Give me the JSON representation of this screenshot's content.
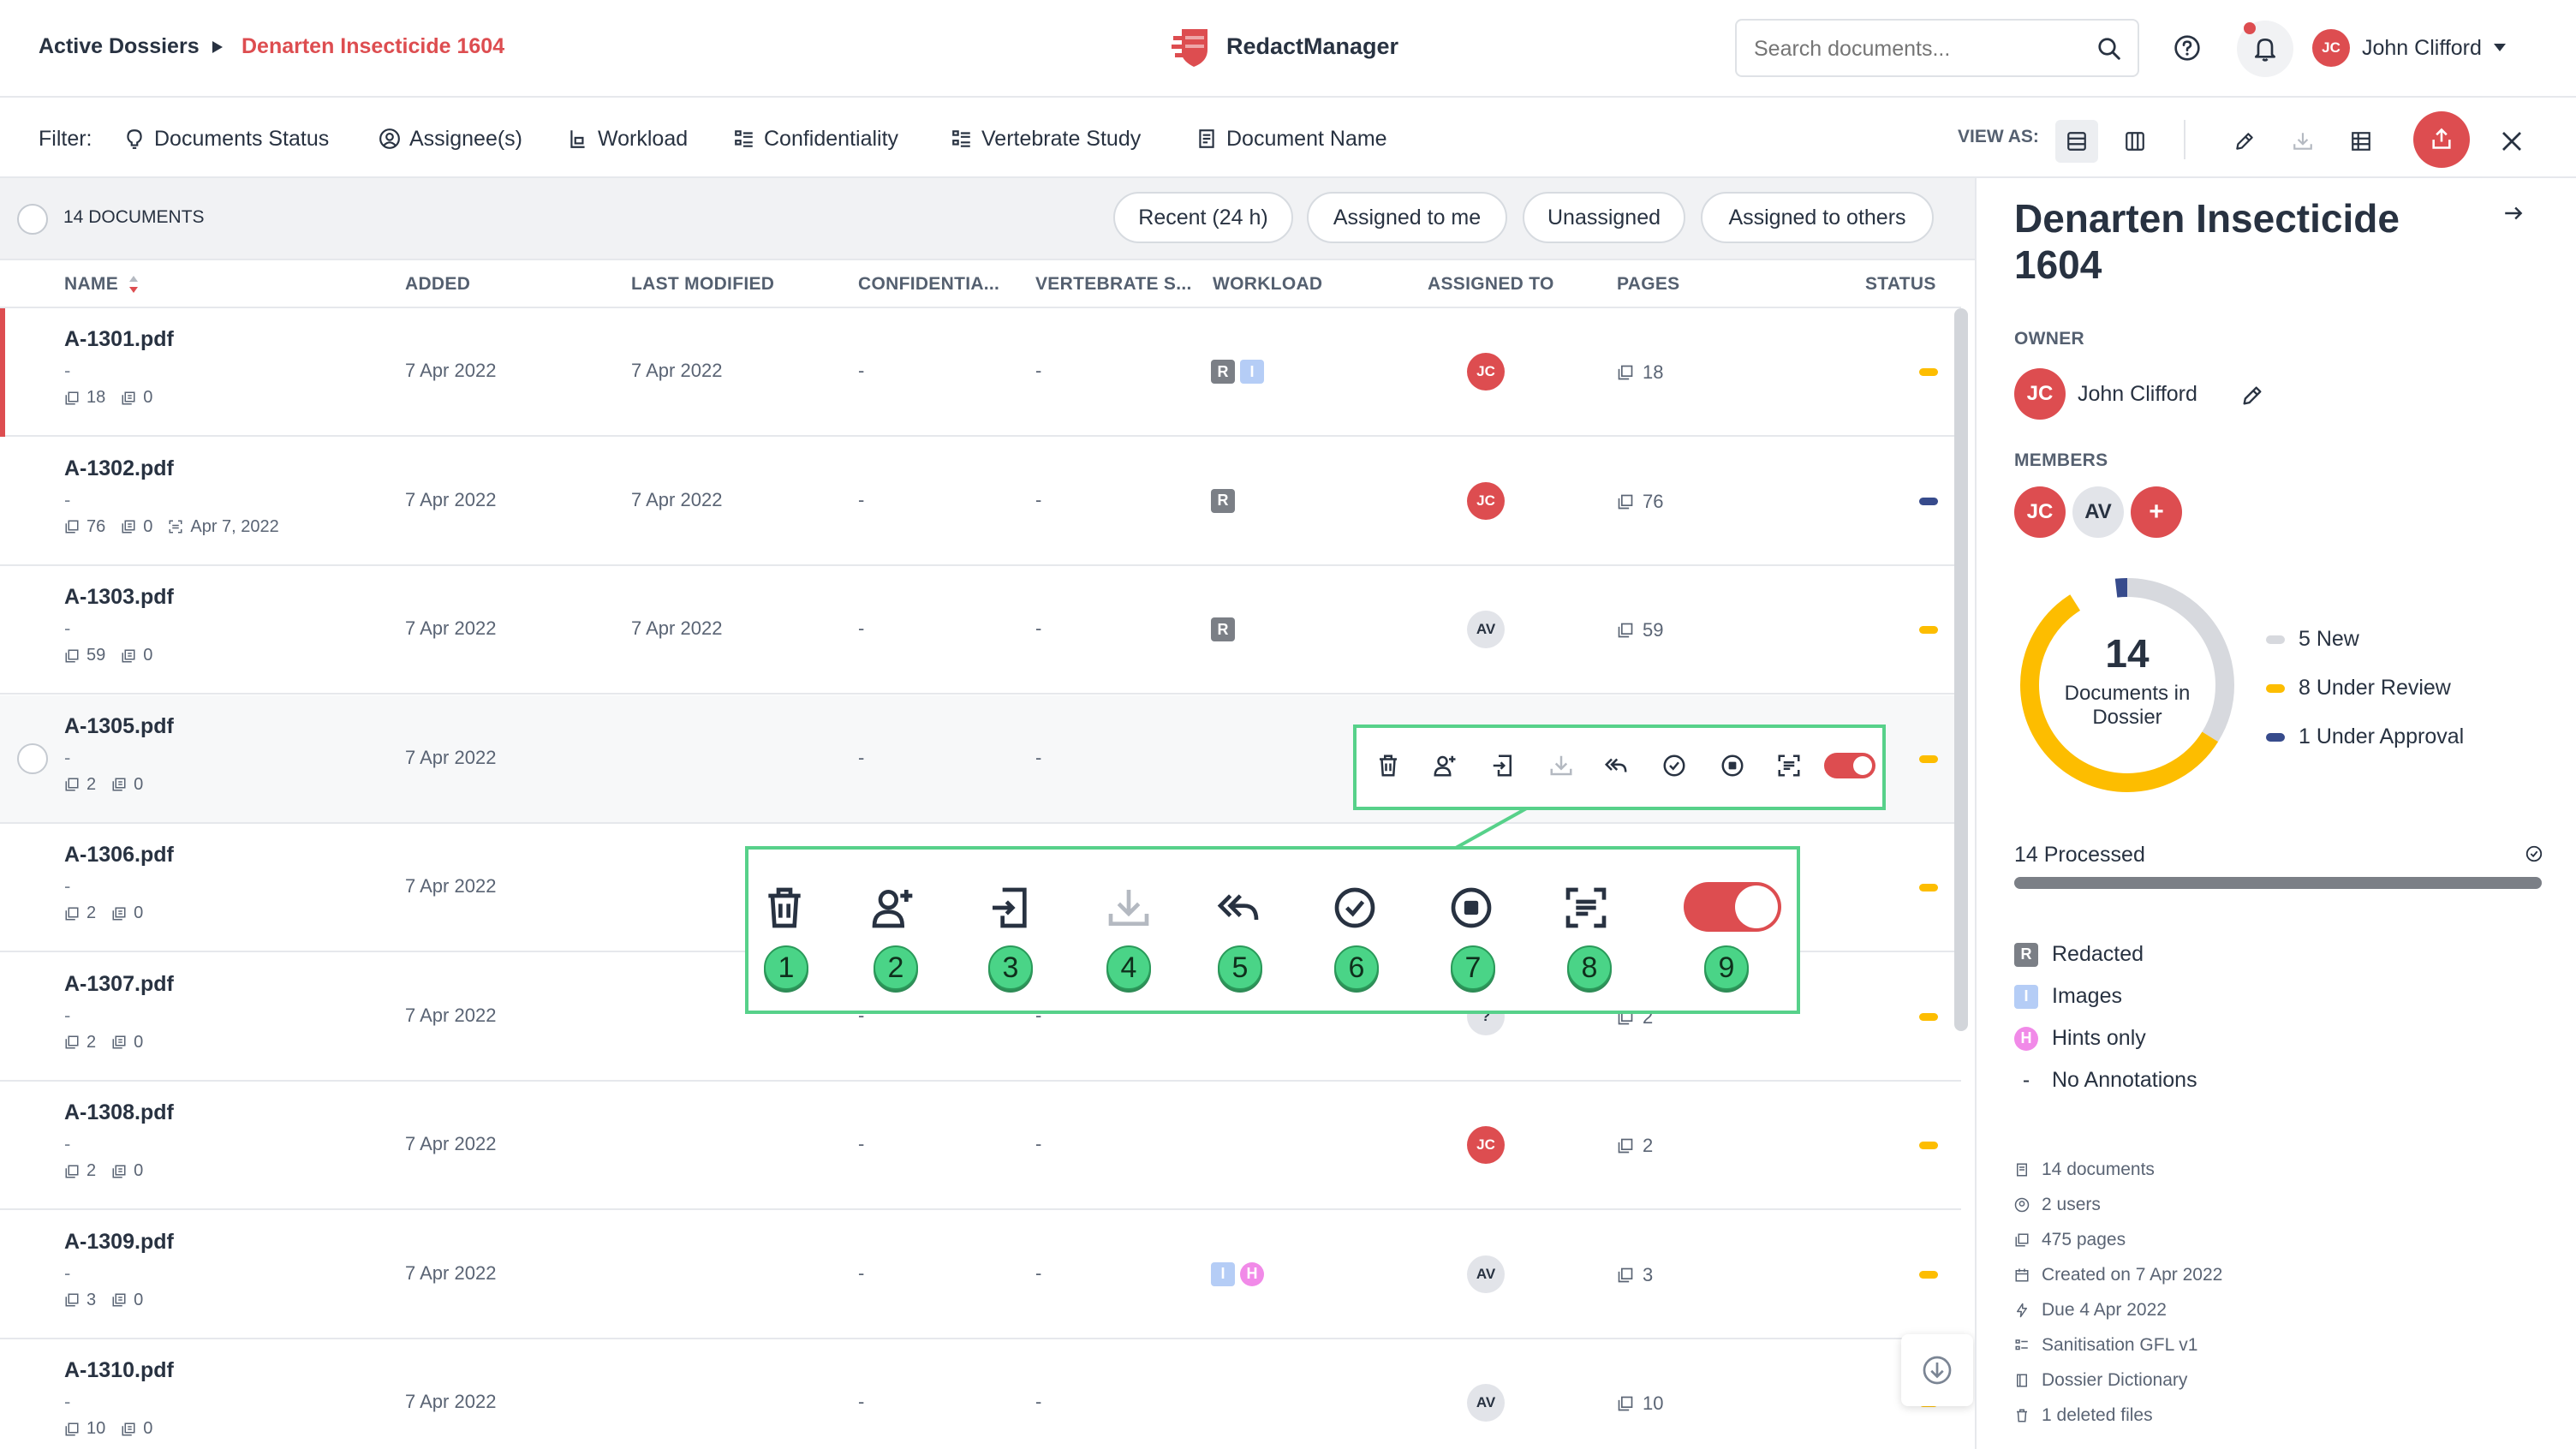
{
  "header": {
    "breadcrumb_root": "Active Dossiers",
    "breadcrumb_current": "Denarten Insecticide 1604",
    "app_name": "RedactManager",
    "search_placeholder": "Search documents...",
    "user_initials": "JC",
    "user_name": "John Clifford"
  },
  "filters": {
    "label": "Filter:",
    "items": [
      "Documents Status",
      "Assignee(s)",
      "Workload",
      "Confidentiality",
      "Vertebrate Study",
      "Document Name"
    ],
    "view_as_label": "VIEW AS:"
  },
  "list": {
    "count_label": "14 DOCUMENTS",
    "quick_filters": [
      "Recent (24 h)",
      "Assigned to me",
      "Unassigned",
      "Assigned to others"
    ],
    "columns": [
      "NAME",
      "ADDED",
      "LAST MODIFIED",
      "CONFIDENTIA...",
      "VERTEBRATE S...",
      "WORKLOAD",
      "ASSIGNED TO",
      "PAGES",
      "STATUS"
    ],
    "rows": [
      {
        "name": "A-1301.pdf",
        "sub": "-",
        "pages_meta": "18",
        "files_meta": "0",
        "ocr_date": "",
        "added": "7 Apr 2022",
        "modified": "7 Apr 2022",
        "conf": "-",
        "vert": "-",
        "workload": [
          "R",
          "I"
        ],
        "assigned": "JC",
        "pages": "18",
        "status": "under-review"
      },
      {
        "name": "A-1302.pdf",
        "sub": "-",
        "pages_meta": "76",
        "files_meta": "0",
        "ocr_date": "Apr 7, 2022",
        "added": "7 Apr 2022",
        "modified": "7 Apr 2022",
        "conf": "-",
        "vert": "-",
        "workload": [
          "R"
        ],
        "assigned": "JC",
        "pages": "76",
        "status": "under-approval"
      },
      {
        "name": "A-1303.pdf",
        "sub": "-",
        "pages_meta": "59",
        "files_meta": "0",
        "ocr_date": "",
        "added": "7 Apr 2022",
        "modified": "7 Apr 2022",
        "conf": "-",
        "vert": "-",
        "workload": [
          "R"
        ],
        "assigned": "AV",
        "pages": "59",
        "status": "under-review"
      },
      {
        "name": "A-1305.pdf",
        "sub": "-",
        "pages_meta": "2",
        "files_meta": "0",
        "ocr_date": "",
        "added": "7 Apr 2022",
        "modified": "",
        "conf": "-",
        "vert": "-",
        "workload": [],
        "assigned": "",
        "pages": "",
        "status": "under-review"
      },
      {
        "name": "A-1306.pdf",
        "sub": "-",
        "pages_meta": "2",
        "files_meta": "0",
        "ocr_date": "",
        "added": "7 Apr 2022",
        "modified": "",
        "conf": "",
        "vert": "",
        "workload": [],
        "assigned": "",
        "pages": "",
        "status": "under-review"
      },
      {
        "name": "A-1307.pdf",
        "sub": "-",
        "pages_meta": "2",
        "files_meta": "0",
        "ocr_date": "",
        "added": "7 Apr 2022",
        "modified": "",
        "conf": "-",
        "vert": "-",
        "workload": [],
        "assigned": "?",
        "pages": "2",
        "status": "under-review"
      },
      {
        "name": "A-1308.pdf",
        "sub": "-",
        "pages_meta": "2",
        "files_meta": "0",
        "ocr_date": "",
        "added": "7 Apr 2022",
        "modified": "",
        "conf": "-",
        "vert": "-",
        "workload": [],
        "assigned": "JC",
        "pages": "2",
        "status": "under-review"
      },
      {
        "name": "A-1309.pdf",
        "sub": "-",
        "pages_meta": "3",
        "files_meta": "0",
        "ocr_date": "",
        "added": "7 Apr 2022",
        "modified": "",
        "conf": "-",
        "vert": "-",
        "workload": [
          "I",
          "H"
        ],
        "assigned": "AV",
        "pages": "3",
        "status": "under-review"
      },
      {
        "name": "A-1310.pdf",
        "sub": "-",
        "pages_meta": "10",
        "files_meta": "0",
        "ocr_date": "",
        "added": "7 Apr 2022",
        "modified": "",
        "conf": "-",
        "vert": "-",
        "workload": [],
        "assigned": "AV",
        "pages": "10",
        "status": "under-review"
      }
    ]
  },
  "zoom_callout": {
    "numbers": [
      "1",
      "2",
      "3",
      "4",
      "5",
      "6",
      "7",
      "8",
      "9"
    ]
  },
  "sidebar": {
    "title": "Denarten Insecticide 1604",
    "owner_label": "OWNER",
    "owner_initials": "JC",
    "owner_name": "John Clifford",
    "members_label": "MEMBERS",
    "members": [
      "JC",
      "AV"
    ],
    "add_member": "+",
    "donut_total": "14",
    "donut_caption_1": "Documents in",
    "donut_caption_2": "Dossier",
    "legend": [
      "5 New",
      "8 Under Review",
      "1 Under Approval"
    ],
    "processed_label": "14 Processed",
    "processed_fraction": 1.0,
    "annotation_legend": [
      "Redacted",
      "Images",
      "Hints only",
      "No Annotations"
    ],
    "annotation_keys": [
      "R",
      "I",
      "H",
      "-"
    ],
    "info": [
      "14 documents",
      "2 users",
      "475 pages",
      "Created on 7 Apr 2022",
      "Due 4 Apr 2022",
      "Sanitisation GFL v1",
      "Dossier Dictionary",
      "1 deleted files"
    ]
  },
  "colors": {
    "brand_red": "#dd4d50",
    "new": "#d7d9de",
    "under_review": "#fdbd00",
    "under_approval": "#374b8c",
    "redacted": "#7b7f86",
    "images": "#b5cdf6",
    "hints": "#f18ae8",
    "callout_border": "#57d18a"
  },
  "chart_data": {
    "type": "pie",
    "title": "",
    "categories": [
      "New",
      "Under Review",
      "Under Approval"
    ],
    "values": [
      5,
      8,
      1
    ]
  }
}
